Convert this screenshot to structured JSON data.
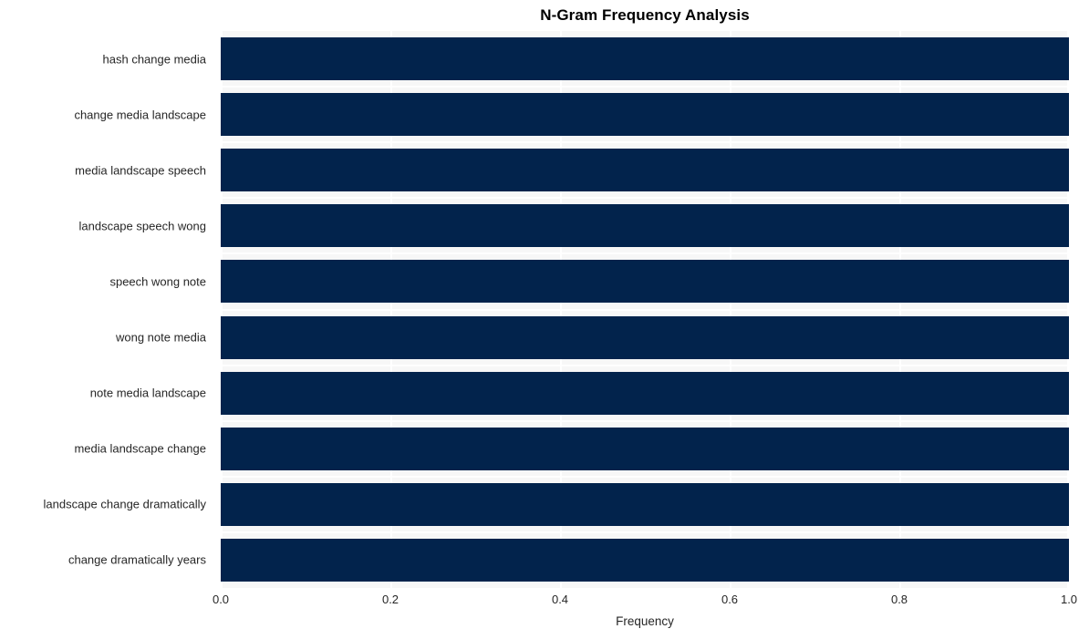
{
  "chart_data": {
    "type": "bar",
    "orientation": "horizontal",
    "title": "N-Gram Frequency Analysis",
    "xlabel": "Frequency",
    "ylabel": "",
    "categories": [
      "hash change media",
      "change media landscape",
      "media landscape speech",
      "landscape speech wong",
      "speech wong note",
      "wong note media",
      "note media landscape",
      "media landscape change",
      "landscape change dramatically",
      "change dramatically years"
    ],
    "values": [
      1.0,
      1.0,
      1.0,
      1.0,
      1.0,
      1.0,
      1.0,
      1.0,
      1.0,
      1.0
    ],
    "xlim": [
      0.0,
      1.0
    ],
    "xticks": [
      "0.0",
      "0.2",
      "0.4",
      "0.6",
      "0.8",
      "1.0"
    ],
    "xtick_values": [
      0.0,
      0.2,
      0.4,
      0.6,
      0.8,
      1.0
    ],
    "grid": true,
    "grid_color": "#ffffff",
    "legend": null,
    "bar_color": "#02234c",
    "plot_background": "#f7f7f7",
    "figure_background": "#ffffff",
    "text_color": "#262626"
  }
}
